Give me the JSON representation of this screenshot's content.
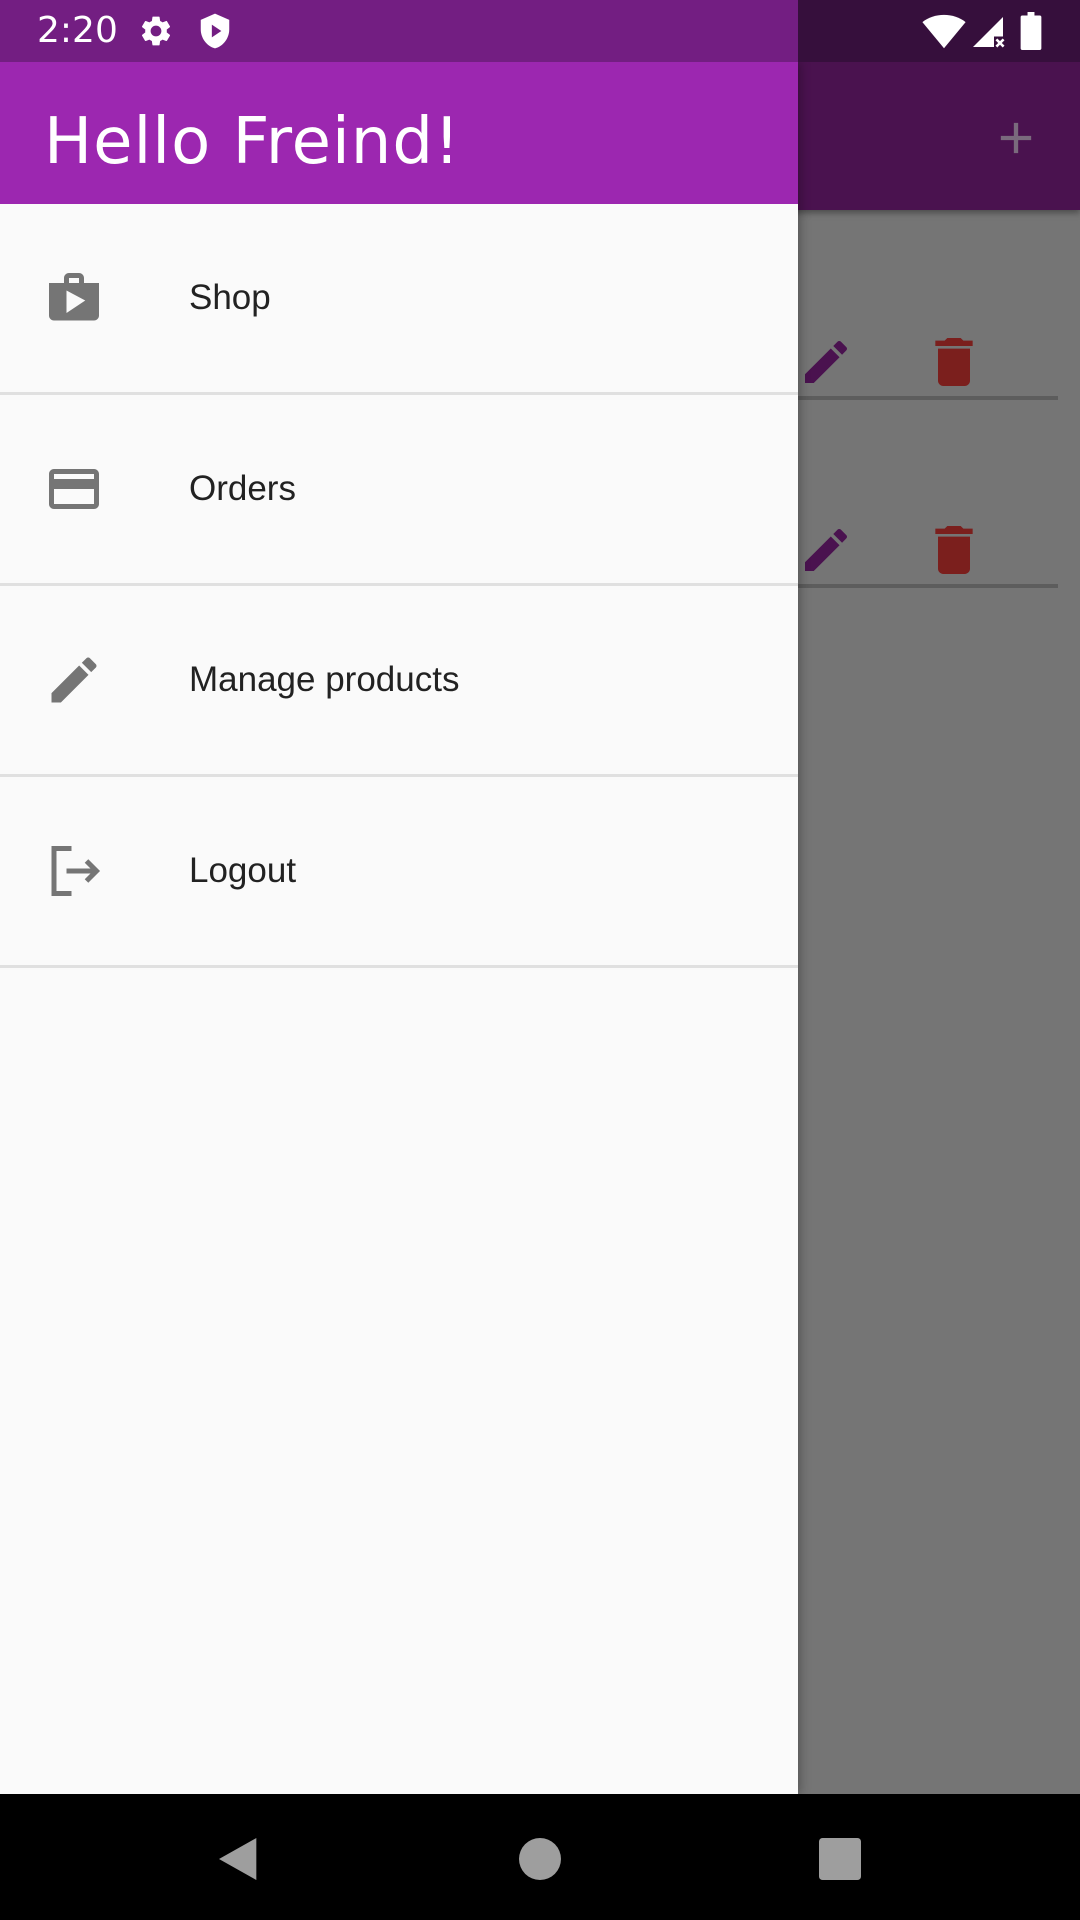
{
  "status_bar": {
    "time": "2:20",
    "icons": [
      "gear-icon",
      "shield-play-icon",
      "wifi-icon",
      "signal-no-data-icon",
      "battery-icon"
    ]
  },
  "drawer": {
    "header_title": "Hello Freind!",
    "items": [
      {
        "label": "Shop",
        "icon": "shop-bag-icon"
      },
      {
        "label": "Orders",
        "icon": "credit-card-icon"
      },
      {
        "label": "Manage products",
        "icon": "pencil-icon"
      },
      {
        "label": "Logout",
        "icon": "logout-icon"
      }
    ]
  },
  "background_app": {
    "appbar_action": "add-icon",
    "rows": [
      {
        "actions": [
          "edit-icon",
          "delete-icon"
        ]
      },
      {
        "actions": [
          "edit-icon",
          "delete-icon"
        ]
      }
    ]
  },
  "nav_bar": {
    "buttons": [
      "back-icon",
      "home-icon",
      "recents-icon"
    ]
  },
  "colors": {
    "primary": "#9c27b0",
    "status_bar": "#731e82",
    "drawer_bg": "#fafafa",
    "scrim": "#757575",
    "edit_icon": "#4a124f",
    "delete_icon": "#7b1f1d"
  }
}
